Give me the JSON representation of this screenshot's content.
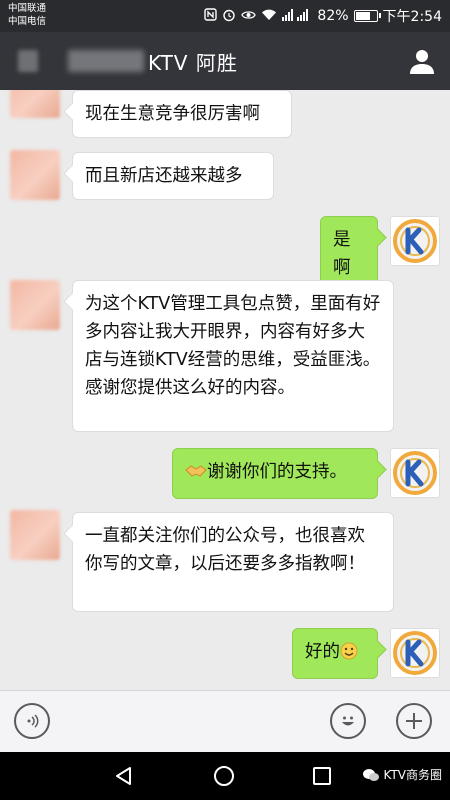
{
  "status_bar": {
    "carrier_1": "中国联通",
    "carrier_2": "中国电信",
    "battery": "82%",
    "time": "下午2:54",
    "battery_level": 0.82
  },
  "header": {
    "title": "KTV  阿胜"
  },
  "messages": [
    {
      "side": "left",
      "text": "现在生意竞争很厉害啊"
    },
    {
      "side": "left",
      "text": "而且新店还越来越多"
    },
    {
      "side": "right",
      "text": "是啊"
    },
    {
      "side": "left",
      "text": "为这个KTV管理工具包点赞，里面有好多内容让我大开眼界，内容有好多大店与连锁KTV经营的思维，受益匪浅。感谢您提供这么好的内容。"
    },
    {
      "side": "right",
      "text": "谢谢你们的支持。",
      "emoji": "handshake-icon"
    },
    {
      "side": "left",
      "text": "一直都关注你们的公众号，也很喜欢你写的文章，以后还要多多指教啊！"
    },
    {
      "side": "right",
      "text": "好的",
      "emoji": "smile-icon"
    }
  ],
  "watermark": {
    "text": "KTV商务圈"
  },
  "colors": {
    "sent_bubble": "#a0e75a",
    "header_bg": "#34353a",
    "chat_bg": "#ebebeb"
  }
}
